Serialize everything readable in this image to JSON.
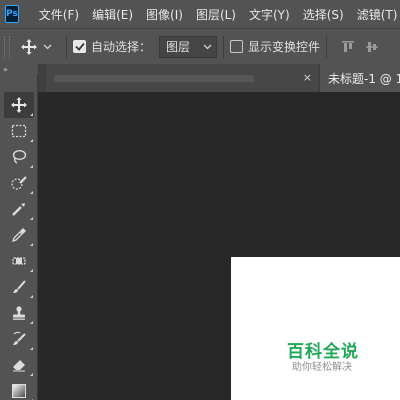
{
  "app": {
    "logo_text": "Ps"
  },
  "menu": [
    "文件(F)",
    "编辑(E)",
    "图像(I)",
    "图层(L)",
    "文字(Y)",
    "选择(S)",
    "滤镜(T)"
  ],
  "options_bar": {
    "auto_select_label": "自动选择：",
    "auto_select_checked": true,
    "layer_select_value": "图层",
    "show_transform_label": "显示变换控件",
    "show_transform_checked": false
  },
  "toolbar_header": "»",
  "tools": [
    "move-tool",
    "rectangular-marquee-tool",
    "lasso-tool",
    "quick-selection-tool",
    "crop-tool",
    "eyedropper-tool",
    "spot-healing-brush-tool",
    "brush-tool",
    "clone-stamp-tool",
    "history-brush-tool",
    "eraser-tool",
    "gradient-tool"
  ],
  "tabs": [
    {
      "label": "",
      "active": false,
      "close": "×"
    },
    {
      "label": "未标题-1 @ 1",
      "active": true
    }
  ],
  "watermark": {
    "title": "百科全说",
    "subtitle": "助你轻松解决"
  },
  "colors": {
    "panel": "#535353",
    "canvas": "#282828",
    "tabbar": "#3f3f3f",
    "watermark_green": "#20a856"
  }
}
